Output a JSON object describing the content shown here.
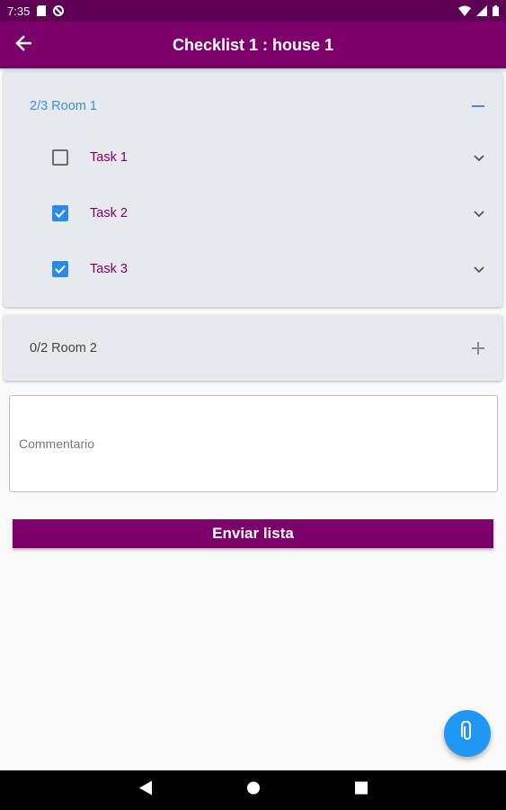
{
  "status_bar": {
    "time": "7:35",
    "icons": [
      "sd-card-icon",
      "no-sync-icon",
      "wifi-icon",
      "signal-icon",
      "battery-icon"
    ]
  },
  "app_bar": {
    "title": "Checklist 1 : house 1",
    "back_icon": "arrow-back-icon"
  },
  "rooms": [
    {
      "label": "2/3 Room 1",
      "expanded": true,
      "toggle_icon": "minus-icon",
      "tasks": [
        {
          "label": "Task 1",
          "checked": false
        },
        {
          "label": "Task 2",
          "checked": true
        },
        {
          "label": "Task 3",
          "checked": true
        }
      ]
    },
    {
      "label": "0/2 Room 2",
      "expanded": false,
      "toggle_icon": "plus-icon"
    }
  ],
  "comment": {
    "placeholder": "Commentario",
    "value": ""
  },
  "send_button": {
    "label": "Enviar lista"
  },
  "fab": {
    "icon": "paperclip-icon"
  },
  "nav_bar": {
    "icons": [
      "back-triangle-icon",
      "home-circle-icon",
      "recents-square-icon"
    ]
  },
  "colors": {
    "primary": "#7b0069",
    "status_bar": "#5e0053",
    "accent": "#2196f3",
    "expanded_header": "#3e8fd6",
    "checkbox_checked": "#2b8ae6"
  }
}
